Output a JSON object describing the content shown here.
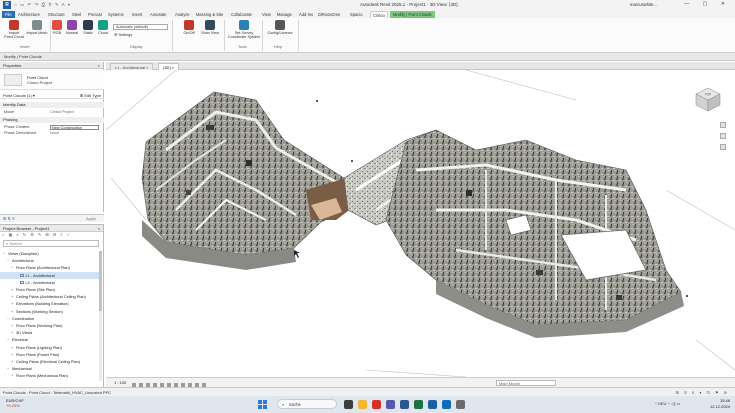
{
  "titlebar": {
    "app_icon_letter": "R",
    "title": "Autodesk Revit 2025.1 - Project1 - 3D View: {3D}",
    "user": "marcuswhite...",
    "quick_access_icons": "⌂ ▭ ↶ ↷ ⎙ ⚲ ✎ A ⌖"
  },
  "ribbon_tabs": [
    "File",
    "Architecture",
    "Structure",
    "Steel",
    "Precast",
    "Systems",
    "Insert",
    "Annotate",
    "Analyze",
    "Massing & Site",
    "Collaborate",
    "View",
    "Manage",
    "Add-Ins",
    "DiRootsOne",
    "Spacio",
    "Cintoo",
    "Modify | Point Clouds"
  ],
  "active_tab": "Cintoo",
  "ribbon": {
    "buttons": [
      {
        "label": "Import\nPoint Cloud",
        "name": "import-point-cloud-button",
        "color": "#c0392b"
      },
      {
        "label": "Import Mesh",
        "name": "import-mesh-button",
        "color": "#7f8c8d"
      },
      {
        "label": "RGB",
        "name": "rgb-button",
        "color": "#e74c3c"
      },
      {
        "label": "Normal",
        "name": "normal-button",
        "color": "#8e44ad"
      },
      {
        "label": "Static",
        "name": "static-button",
        "color": "#2c3e50"
      },
      {
        "label": "Cloud",
        "name": "cloud-button",
        "color": "#16a085"
      },
      {
        "label": "On/Off",
        "name": "on-off-button",
        "color": "#c0392b"
      },
      {
        "label": "Scan View",
        "name": "scan-view-button",
        "color": "#34495e"
      },
      {
        "label": "Set Survey\nCoordinate System",
        "name": "set-survey-button",
        "color": "#2980b9"
      },
      {
        "label": "Config/License",
        "name": "config-license-button",
        "color": "#555555"
      }
    ],
    "display_dropdown": "Automatic (default)",
    "settings_label": "Settings",
    "groups": [
      "Insert",
      "Display",
      "Tools",
      "Help"
    ]
  },
  "modify_bar": "Modify | Point Clouds",
  "properties": {
    "header": "Properties",
    "close": "×",
    "type_line1": "Point Cloud",
    "type_line2": "Cintoo Project",
    "filter": "Point Clouds (1)",
    "edit_type": "Edit Type",
    "sections": [
      {
        "title": "Identity Data",
        "rows": [
          {
            "key": "Model",
            "value": "Cintoo Project"
          }
        ]
      },
      {
        "title": "Phasing",
        "rows": [
          {
            "key": "Phase Created",
            "value": "New Construction",
            "boxed": true
          },
          {
            "key": "Phase Demolished",
            "value": "None"
          }
        ]
      }
    ],
    "apply": "Apply",
    "footer_icons": "⊞ ⇅ ⚲"
  },
  "browser": {
    "header": "Project Browser - Project1",
    "close": "×",
    "toolbar_icons": "⌂ ▦ ⌕ ↻ ⚙ ✎ ⊞ ⊟ ≡ ✓",
    "search_placeholder": "Search",
    "tree": [
      {
        "label": "Views (Discipline)",
        "level": 0,
        "tw": "−"
      },
      {
        "label": "Architectural",
        "level": 1,
        "tw": "−"
      },
      {
        "label": "Floor Plans (Architectural Plan)",
        "level": 2,
        "tw": "−"
      },
      {
        "label": "L1 - Architectural",
        "level": 3,
        "tw": "",
        "view": true,
        "selected": true
      },
      {
        "label": "L2 - Architectural",
        "level": 3,
        "tw": "",
        "view": true
      },
      {
        "label": "Floor Plans (Site Plan)",
        "level": 2,
        "tw": "+"
      },
      {
        "label": "Ceiling Plans (Architectural Ceiling Plan)",
        "level": 2,
        "tw": "+"
      },
      {
        "label": "Elevations (Building Elevation)",
        "level": 2,
        "tw": "+"
      },
      {
        "label": "Sections (Working Section)",
        "level": 2,
        "tw": "+"
      },
      {
        "label": "Coordination",
        "level": 1,
        "tw": "−"
      },
      {
        "label": "Floor Plans (Working Plan)",
        "level": 2,
        "tw": "+"
      },
      {
        "label": "3D Views",
        "level": 2,
        "tw": "+"
      },
      {
        "label": "Electrical",
        "level": 1,
        "tw": "−"
      },
      {
        "label": "Floor Plans (Lighting Plan)",
        "level": 2,
        "tw": "+"
      },
      {
        "label": "Floor Plans (Power Plan)",
        "level": 2,
        "tw": "+"
      },
      {
        "label": "Ceiling Plans (Electrical Ceiling Plan)",
        "level": 2,
        "tw": "+"
      },
      {
        "label": "Mechanical",
        "level": 1,
        "tw": "−"
      },
      {
        "label": "Floor Plans (Mechanical Plan)",
        "level": 2,
        "tw": "+"
      }
    ]
  },
  "view_tabs": [
    {
      "label": "L1 - Architectural",
      "active": false
    },
    {
      "label": "{3D}",
      "active": true
    }
  ],
  "view_control": {
    "scale": "1 : 100",
    "model_dropdown": "Main Model"
  },
  "status": {
    "text": "Point Clouds : Point Cloud : Telematik_HVAC_Unscaled PPC",
    "right_icons": "⊞ ⚲ 0 ▾ ⊡ ⚑ ⊘"
  },
  "taskbar": {
    "weather_line1": "EUR/CHF",
    "weather_line2": "+0.29%",
    "search": "Suche",
    "tray": "^ DEU ◔ ◁) ▭",
    "time": "15:46",
    "date": "12.12.2024",
    "apps": [
      {
        "name": "task-view-icon",
        "color": "#3c3c3c"
      },
      {
        "name": "explorer-icon",
        "color": "#f2b632"
      },
      {
        "name": "chrome-icon",
        "color": "#d93025"
      },
      {
        "name": "teams-icon",
        "color": "#5558af"
      },
      {
        "name": "word-icon",
        "color": "#2b5797"
      },
      {
        "name": "excel-icon",
        "color": "#1e7145"
      },
      {
        "name": "revit-icon",
        "color": "#1c5fa8"
      },
      {
        "name": "outlook-icon",
        "color": "#0f6cbd"
      },
      {
        "name": "store-icon",
        "color": "#6b6b6b"
      }
    ]
  },
  "navcube": {
    "label": "TOP"
  }
}
